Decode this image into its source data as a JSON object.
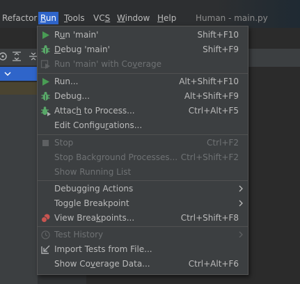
{
  "menubar": {
    "items": [
      {
        "pre": "",
        "mn": "",
        "post": "Refactor"
      },
      {
        "pre": "",
        "mn": "R",
        "post": "un"
      },
      {
        "pre": "",
        "mn": "T",
        "post": "ools"
      },
      {
        "pre": "VC",
        "mn": "S",
        "post": ""
      },
      {
        "pre": "",
        "mn": "W",
        "post": "indow"
      },
      {
        "pre": "",
        "mn": "H",
        "post": "elp"
      }
    ],
    "window_title": "Human - main.py"
  },
  "run_menu": {
    "items": [
      {
        "pre": "R",
        "mn": "u",
        "post": "n 'main'",
        "shortcut": "Shift+F10",
        "icon": "run-icon",
        "enabled": true
      },
      {
        "pre": "",
        "mn": "D",
        "post": "ebug 'main'",
        "shortcut": "Shift+F9",
        "icon": "debug-icon",
        "enabled": true
      },
      {
        "pre": "Run 'main' with Co",
        "mn": "v",
        "post": "erage",
        "shortcut": "",
        "icon": "coverage-icon",
        "enabled": false
      },
      {
        "pre": "Run",
        "mn": "",
        "post": "...",
        "shortcut": "Alt+Shift+F10",
        "icon": "run-icon",
        "enabled": true
      },
      {
        "pre": "Debug",
        "mn": "",
        "post": "...",
        "shortcut": "Alt+Shift+F9",
        "icon": "debug-icon",
        "enabled": true
      },
      {
        "pre": "Attac",
        "mn": "h",
        "post": " to Process...",
        "shortcut": "Ctrl+Alt+F5",
        "icon": "attach-debugger-icon",
        "enabled": true
      },
      {
        "pre": "Edit Configu",
        "mn": "r",
        "post": "ations...",
        "shortcut": "",
        "icon": "",
        "enabled": true
      },
      {
        "pre": "Stop",
        "mn": "",
        "post": "",
        "shortcut": "Ctrl+F2",
        "icon": "stop-icon",
        "enabled": false
      },
      {
        "pre": "Stop Background Processes...",
        "mn": "",
        "post": "",
        "shortcut": "Ctrl+Shift+F2",
        "icon": "",
        "enabled": false
      },
      {
        "pre": "Show Running List",
        "mn": "",
        "post": "",
        "shortcut": "",
        "icon": "",
        "enabled": false
      },
      {
        "pre": "Debugging Actions",
        "mn": "",
        "post": "",
        "shortcut": "",
        "icon": "",
        "enabled": true,
        "submenu": true
      },
      {
        "pre": "Toggle Breakpoint",
        "mn": "",
        "post": "",
        "shortcut": "",
        "icon": "",
        "enabled": true,
        "submenu": true
      },
      {
        "pre": "View Brea",
        "mn": "k",
        "post": "points...",
        "shortcut": "Ctrl+Shift+F8",
        "icon": "breakpoints-icon",
        "enabled": true
      },
      {
        "pre": "Test History",
        "mn": "",
        "post": "",
        "shortcut": "",
        "icon": "history-icon",
        "enabled": false,
        "submenu": true
      },
      {
        "pre": "Import Tests from File...",
        "mn": "",
        "post": "",
        "shortcut": "",
        "icon": "import-icon",
        "enabled": true
      },
      {
        "pre": "Show Co",
        "mn": "v",
        "post": "erage Data...",
        "shortcut": "Ctrl+Alt+F6",
        "icon": "",
        "enabled": true
      }
    ]
  },
  "colors": {
    "menu_bg": "#3c3f41",
    "highlight": "#2f65ca",
    "run_green": "#499c54",
    "debug_green": "#59a869",
    "breakpoint_red": "#c75450",
    "disabled_text": "#6f7274"
  }
}
